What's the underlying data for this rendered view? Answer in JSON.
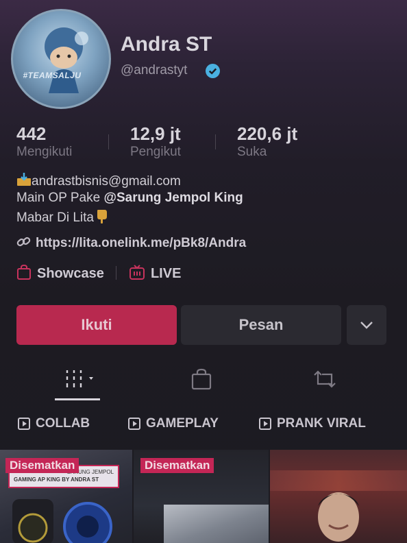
{
  "profile": {
    "avatar_tag": "#TEAMSALJU",
    "name": "Andra ST",
    "handle": "@andrastyt"
  },
  "stats": [
    {
      "value": "442",
      "label": "Mengikuti"
    },
    {
      "value": "12,9 jt",
      "label": "Pengikut"
    },
    {
      "value": "220,6 jt",
      "label": "Suka"
    }
  ],
  "bio": {
    "line1": "andrastbisnis@gmail.com",
    "line2_prefix": "Main OP Pake ",
    "line2_mention": "@Sarung Jempol King",
    "line3": "Mabar Di Lita"
  },
  "link": "https://lita.onelink.me/pBk8/Andra",
  "showcase_label": "Showcase",
  "live_label": "LIVE",
  "buttons": {
    "follow": "Ikuti",
    "message": "Pesan"
  },
  "playlists": [
    "COLLAB",
    "GAMEPLAY",
    "PRANK VIRAL"
  ],
  "videos": [
    {
      "badge": "Disematkan",
      "caption_line1": "SARUNG JEMPOL",
      "caption_line2": "GAMING AP KING BY ANDRA ST"
    },
    {
      "badge": "Disematkan"
    },
    {
      "badge": ""
    }
  ],
  "colors": {
    "accent": "#b8294f",
    "verified": "#4ab0e0"
  }
}
